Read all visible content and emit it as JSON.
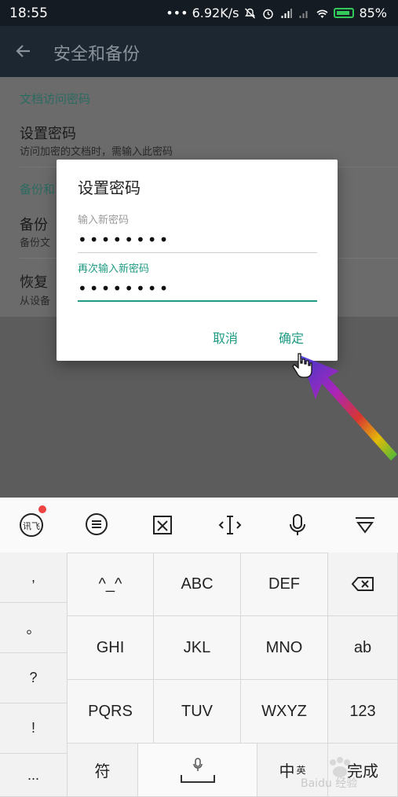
{
  "status_bar": {
    "time": "18:55",
    "right_text": "••• 6.92K/s",
    "battery": "85%"
  },
  "app_bar": {
    "title": "安全和备份"
  },
  "settings": {
    "section1": "文档访问密码",
    "item1_title": "设置密码",
    "item1_sub": "访问加密的文档时，需输入此密码",
    "section2": "备份和",
    "item2_title": "备份",
    "item2_sub": "备份文",
    "item3_title": "恢复",
    "item3_sub": "从设备"
  },
  "dialog": {
    "title": "设置密码",
    "field1_label": "输入新密码",
    "field1_value": "••••••••",
    "field2_label": "再次输入新密码",
    "field2_value": "••••••••",
    "cancel": "取消",
    "ok": "确定"
  },
  "keyboard": {
    "toolbar_icons": [
      "voice-assistant-icon",
      "chat-bubble-icon",
      "clipboard-icon",
      "cursor-move-icon",
      "microphone-icon",
      "collapse-keyboard-icon"
    ],
    "punct": [
      ",",
      "。",
      "?",
      "!",
      "..."
    ],
    "rows": [
      [
        "^_^",
        "ABC",
        "DEF",
        "⌫"
      ],
      [
        "GHI",
        "JKL",
        "MNO",
        "ab"
      ],
      [
        "PQRS",
        "TUV",
        "WXYZ",
        "123"
      ]
    ],
    "bottom": {
      "symbol": "符",
      "chinese": "中",
      "english": "英",
      "done": "完成"
    }
  },
  "watermark": "Baidu 经验"
}
